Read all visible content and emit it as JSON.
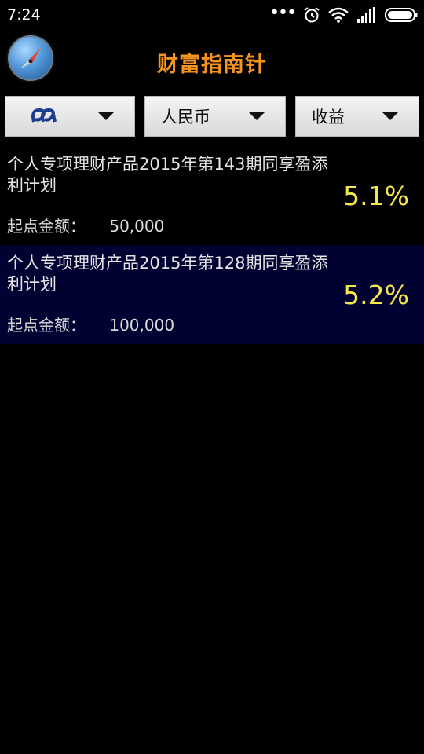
{
  "status_bar": {
    "time": "7:24",
    "icons": [
      "more-dots-icon",
      "alarm-icon",
      "wifi-icon",
      "signal-icon",
      "battery-icon"
    ]
  },
  "header": {
    "title": "财富指南针",
    "logo_icon": "compass-icon",
    "title_color": "#f7941d"
  },
  "filters": {
    "bank": {
      "icon": "spdb-bank-logo-icon",
      "color": "#1e3d8f"
    },
    "currency": {
      "label": "人民币"
    },
    "sort": {
      "label": "收益"
    }
  },
  "products": [
    {
      "name": "个人专项理财产品2015年第143期同享盈添利计划",
      "amount_label": "起点金额：",
      "amount": "50,000",
      "rate": "5.1%"
    },
    {
      "name": "个人专项理财产品2015年第128期同享盈添利计划",
      "amount_label": "起点金额：",
      "amount": "100,000",
      "rate": "5.2%"
    }
  ],
  "colors": {
    "background": "#000000",
    "alt_row": "#010132",
    "rate": "#f7e94a"
  }
}
